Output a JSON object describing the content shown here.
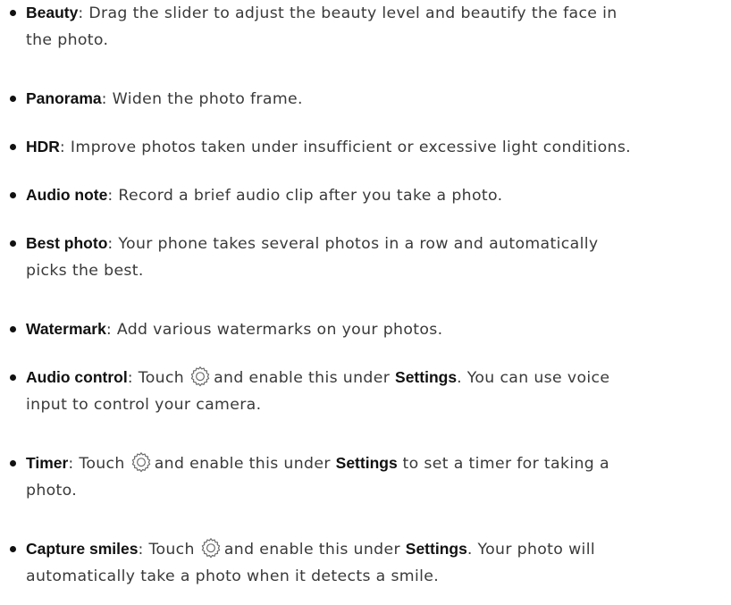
{
  "items": [
    {
      "term": "Beauty",
      "line1": ": Drag the slider to adjust the beauty level and beautify the face in",
      "line2": "the photo."
    },
    {
      "term": "Panorama",
      "line1": ": Widen the photo frame."
    },
    {
      "term": "HDR",
      "line1": ": Improve photos taken under insufficient or excessive light conditions."
    },
    {
      "term": "Audio note",
      "line1": ": Record a brief audio clip after you take a photo."
    },
    {
      "term": "Best photo",
      "line1": ": Your phone takes several photos in a row and automatically",
      "line2": "picks the best."
    },
    {
      "term": "Watermark",
      "line1": ": Add various watermarks on your photos."
    },
    {
      "term": "Audio control",
      "pre": ": Touch",
      "mid": "and enable this under",
      "strong": "Settings",
      "post": ". You can use voice",
      "line2": "input to control your camera."
    },
    {
      "term": "Timer",
      "pre": ": Touch",
      "mid": "and enable this under",
      "strong": "Settings",
      "post": "to set a timer for taking a",
      "line2": "photo."
    },
    {
      "term": "Capture smiles",
      "pre": ": Touch",
      "mid": "and enable this under",
      "strong": "Settings",
      "post": ". Your photo will",
      "line2": "automatically take a photo when it detects a smile."
    }
  ]
}
